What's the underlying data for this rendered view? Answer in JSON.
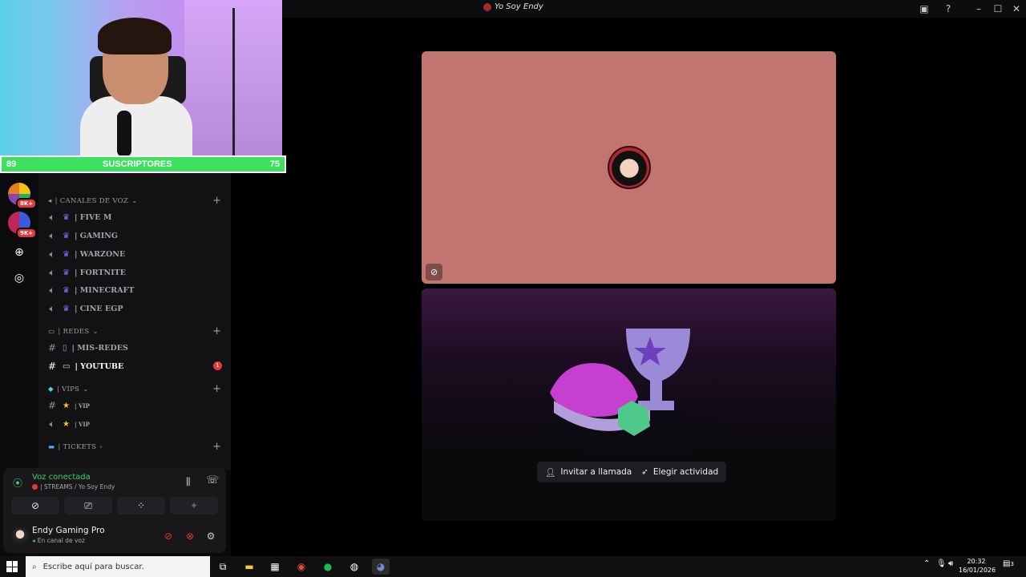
{
  "window": {
    "title": "Yo Soy Endy"
  },
  "overlay": {
    "sub_left": "89",
    "sub_label": "SUSCRIPTORES",
    "sub_right": "75"
  },
  "rail": {
    "badges": [
      "8K+",
      "9K+"
    ]
  },
  "channels": {
    "voice_category": "| CANALES DE VOZ",
    "voice": [
      "| FIVE M",
      "|  GAMING",
      "| WARZONE",
      "| FORTNITE",
      "| MINECRAFT",
      "| CINE EGP"
    ],
    "redes_category": "| REDES",
    "redes": [
      "| MIS-REDES",
      "| YOUTUBE"
    ],
    "youtube_unread": "1",
    "vips_category": "| VIPS",
    "vips": [
      "| VIP",
      "| VIP"
    ],
    "tickets_category": "| TICKETS"
  },
  "voice_panel": {
    "status": "Voz conectada",
    "channel": "| STREAMS / Yo Soy Endy",
    "user_name": "Endy Gaming Pro",
    "user_status": "En canal de voz"
  },
  "stage": {
    "invite_label": "Invitar a llamada",
    "activity_label": "Elegir actividad"
  },
  "taskbar": {
    "search_placeholder": "Escribe aquí para buscar.",
    "time": "20:32",
    "date": "16/01/2026",
    "notifications": "3"
  },
  "colors": {
    "accent_green": "#3de05f",
    "tile_top": "#c27570",
    "danger": "#e0393e"
  }
}
